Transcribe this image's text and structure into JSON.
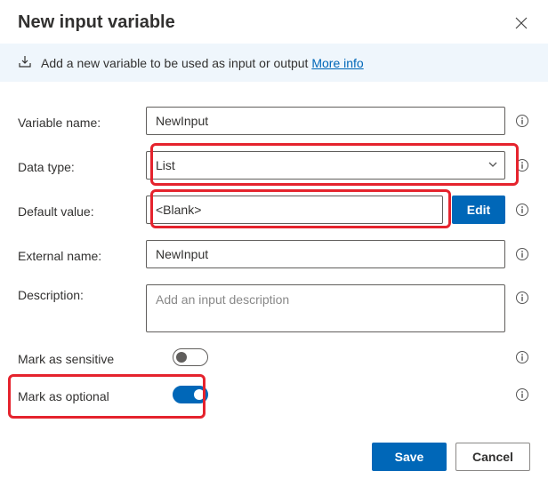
{
  "header": {
    "title": "New input variable"
  },
  "banner": {
    "text": "Add a new variable to be used as input or output ",
    "link_label": "More info"
  },
  "fields": {
    "variable_name": {
      "label": "Variable name:",
      "value": "NewInput"
    },
    "data_type": {
      "label": "Data type:",
      "value": "List"
    },
    "default_value": {
      "label": "Default value:",
      "value": "<Blank>",
      "edit_label": "Edit"
    },
    "external_name": {
      "label": "External name:",
      "value": "NewInput"
    },
    "description": {
      "label": "Description:",
      "placeholder": "Add an input description"
    },
    "mark_sensitive": {
      "label": "Mark as sensitive",
      "value": false
    },
    "mark_optional": {
      "label": "Mark as optional",
      "value": true
    }
  },
  "footer": {
    "save_label": "Save",
    "cancel_label": "Cancel"
  }
}
